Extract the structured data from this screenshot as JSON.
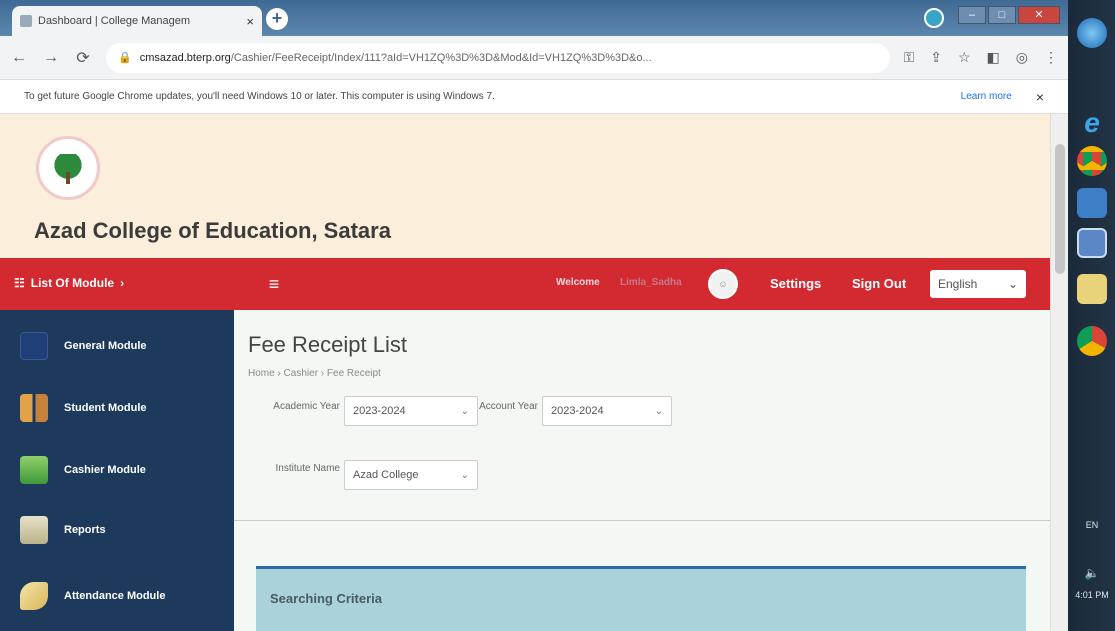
{
  "browser": {
    "tab_title": "Dashboard | College Managem",
    "tab_close": "×",
    "new_tab": "+",
    "url_domain": "cmsazad.bterp.org",
    "url_path": "/Cashier/FeeReceipt/Index/111?aId=VH1ZQ%3D%3D&Mod&Id=VH1ZQ%3D%3D&o...",
    "info_message": "To get future Google Chrome updates, you'll need Windows 10 or later. This computer is using Windows 7.",
    "learn_more": "Learn more",
    "info_close": "×"
  },
  "header": {
    "college_name": "Azad College of Education, Satara"
  },
  "topbar": {
    "module_list": "List Of Module",
    "welcome": "Welcome",
    "user_name": "Limla_Sadha",
    "settings": "Settings",
    "sign_out": "Sign Out",
    "language": "English"
  },
  "sidebar": {
    "items": [
      {
        "label": "General Module"
      },
      {
        "label": "Student Module"
      },
      {
        "label": "Cashier Module"
      },
      {
        "label": "Reports"
      },
      {
        "label": "Attendance Module"
      }
    ]
  },
  "main": {
    "page_title": "Fee Receipt List",
    "breadcrumb": "Home › Cashier › Fee Receipt",
    "academic_year_label": "Academic Year",
    "academic_year_value": "2023-2024",
    "account_year_label": "Account Year",
    "account_year_value": "2023-2024",
    "institute_label": "Institute Name",
    "institute_value": "Azad College",
    "searching_criteria": "Searching Criteria"
  },
  "taskbar": {
    "lang": "EN",
    "time": "4:01 PM"
  },
  "colors": {
    "header_bg": "#fbeeda",
    "topbar_red": "#d32a32",
    "sidebar_navy": "#1d3a5d",
    "panel_teal": "#a9d2da"
  }
}
